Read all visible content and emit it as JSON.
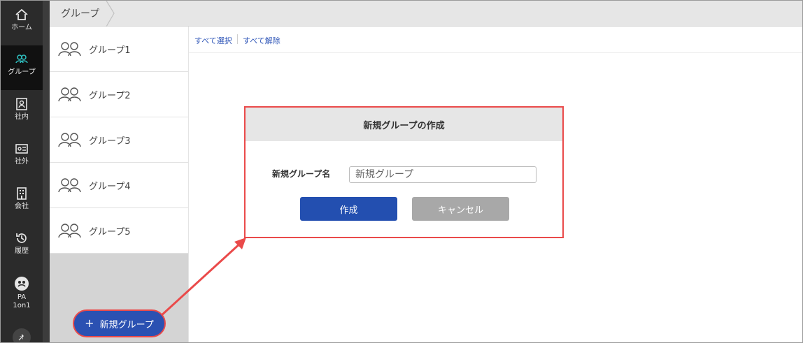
{
  "nav": {
    "items": [
      {
        "label": "ホーム",
        "icon": "home-icon"
      },
      {
        "label": "グループ",
        "icon": "group-icon",
        "active": true
      },
      {
        "label": "社内",
        "icon": "internal-directory-icon"
      },
      {
        "label": "社外",
        "icon": "external-card-icon"
      },
      {
        "label": "会社",
        "icon": "building-icon"
      },
      {
        "label": "履歴",
        "icon": "history-icon"
      },
      {
        "label": "PA\n1on1",
        "icon": "pa-1on1-icon"
      }
    ],
    "pin_icon": "pin-icon"
  },
  "breadcrumb": {
    "current": "グループ"
  },
  "groups": [
    {
      "name": "グループ1"
    },
    {
      "name": "グループ2"
    },
    {
      "name": "グループ3"
    },
    {
      "name": "グループ4"
    },
    {
      "name": "グループ5"
    }
  ],
  "selection": {
    "select_all": "すべて選択",
    "deselect_all": "すべて解除"
  },
  "dialog": {
    "title": "新規グループの作成",
    "field_label": "新規グループ名",
    "field_placeholder": "新規グループ",
    "create_label": "作成",
    "cancel_label": "キャンセル"
  },
  "new_group_button": {
    "plus": "+",
    "label": "新規グループ"
  },
  "colors": {
    "accent_blue": "#234fb0",
    "annotation_red": "#ea4a4a",
    "nav_bg": "#2b2b2b",
    "nav_active_icon": "#2fc1c1"
  }
}
